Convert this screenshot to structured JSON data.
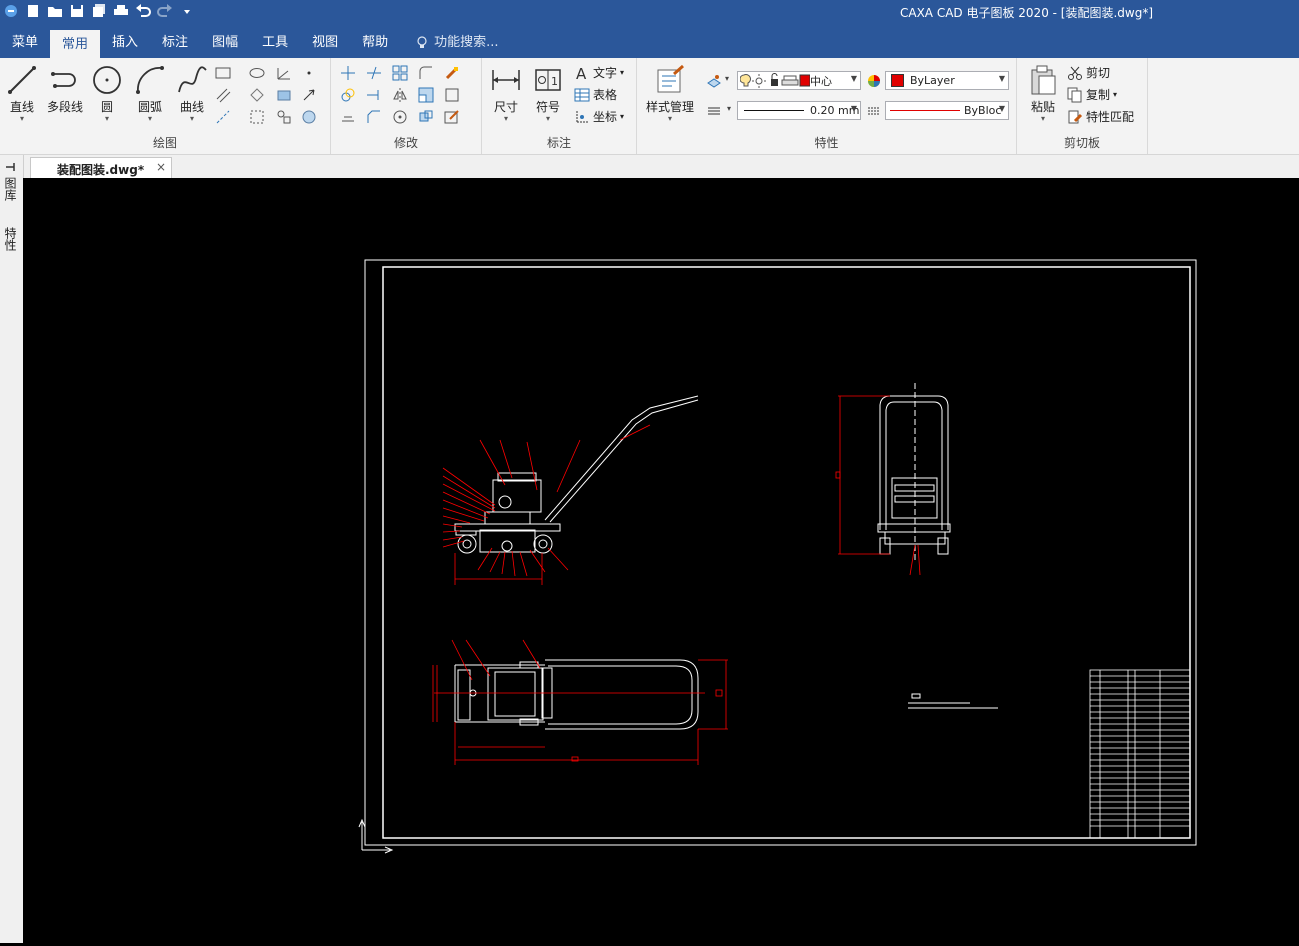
{
  "window": {
    "title": "CAXA CAD 电子图板 2020 - [装配图装.dwg*]"
  },
  "quick_access": [
    "app-logo-icon",
    "new-file-icon",
    "open-file-icon",
    "save-icon",
    "save-all-icon",
    "print-icon",
    "undo-icon",
    "redo-icon",
    "customize-icon"
  ],
  "menu": {
    "tabs": [
      "菜单",
      "常用",
      "插入",
      "标注",
      "图幅",
      "工具",
      "视图",
      "帮助"
    ],
    "active_tab": "常用",
    "search_label": "功能搜索..."
  },
  "ribbon": {
    "draw": {
      "label": "绘图",
      "buttons": [
        "直线",
        "多段线",
        "圆",
        "圆弧",
        "曲线"
      ]
    },
    "modify": {
      "label": "修改"
    },
    "annotate": {
      "label": "标注",
      "buttons": [
        "尺寸",
        "符号"
      ],
      "small": [
        "文字",
        "表格",
        "坐标"
      ]
    },
    "properties": {
      "label": "特性",
      "style_button": "样式管理",
      "layer_value": "中心",
      "color_value": "ByLayer",
      "lineweight_value": "0.20 mm",
      "linetype_value": "ByBlock"
    },
    "clipboard": {
      "label": "剪切板",
      "paste": "粘贴",
      "small": [
        "剪切",
        "复制",
        "特性匹配"
      ]
    }
  },
  "document": {
    "tab_label": "装配图装.dwg*",
    "close": "×"
  },
  "left_panel": {
    "tabs": [
      "图库",
      "特性"
    ]
  },
  "colors": {
    "title_bar": "#2b579a",
    "ribbon_bg": "#f3f3f3",
    "canvas_bg": "#000000",
    "drawing_white": "#ffffff",
    "drawing_red": "#ff0000",
    "layer_swatch": "#e00000"
  }
}
